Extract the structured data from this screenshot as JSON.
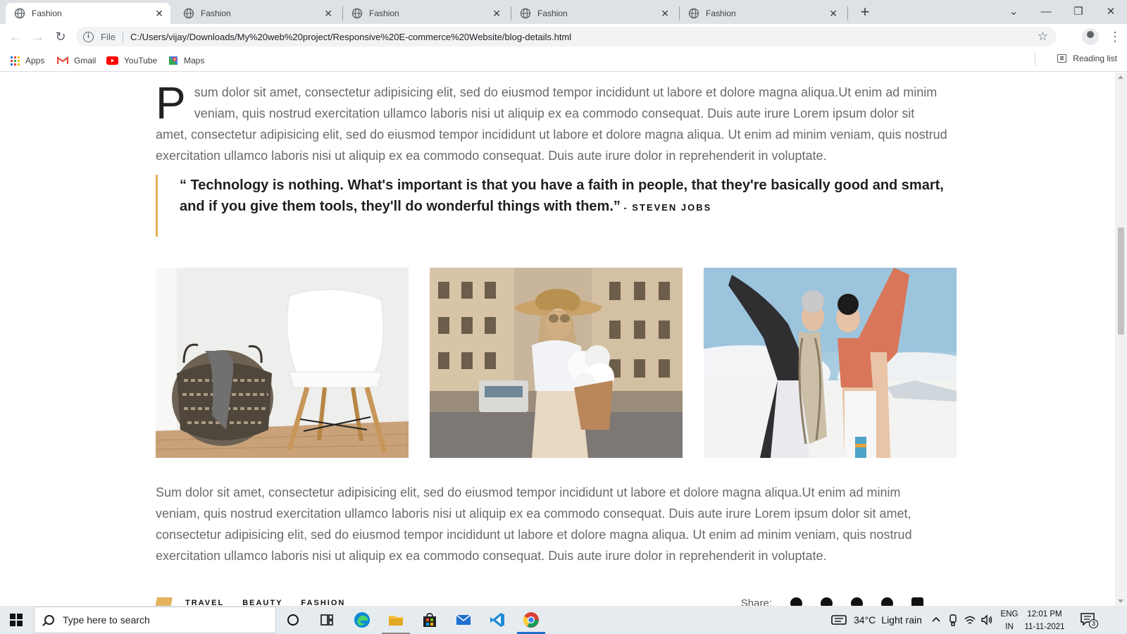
{
  "browser": {
    "tabs": [
      {
        "title": "Fashion",
        "active": true
      },
      {
        "title": "Fashion",
        "active": false
      },
      {
        "title": "Fashion",
        "active": false
      },
      {
        "title": "Fashion",
        "active": false
      },
      {
        "title": "Fashion",
        "active": false
      }
    ],
    "tab_close_glyph": "✕",
    "new_tab_glyph": "+",
    "window_controls": {
      "tab_search": "⌄",
      "minimize": "—",
      "restore": "❐",
      "close": "✕"
    },
    "nav": {
      "back": "←",
      "forward": "→",
      "reload": "↻"
    },
    "address": {
      "scheme_label": "File",
      "url": "C:/Users/vijay/Downloads/My%20web%20project/Responsive%20E-commerce%20Website/blog-details.html",
      "star_glyph": "☆"
    },
    "menu_glyph": "⋮",
    "bookmarks": [
      {
        "label": "Apps",
        "icon": "apps-grid-icon"
      },
      {
        "label": "Gmail",
        "icon": "gmail-icon"
      },
      {
        "label": "YouTube",
        "icon": "youtube-icon"
      },
      {
        "label": "Maps",
        "icon": "maps-icon"
      }
    ],
    "reading_list": "Reading list"
  },
  "article": {
    "dropcap": "P",
    "paragraph_1": "sum dolor sit amet, consectetur adipisicing elit, sed do eiusmod tempor incididunt ut labore et dolore magna aliqua.Ut enim ad minim veniam, quis nostrud exercitation ullamco laboris nisi ut aliquip ex ea commodo consequat. Duis aute irure Lorem ipsum dolor sit amet, consectetur adipisicing elit, sed do eiusmod tempor incididunt ut labore et dolore magna aliqua. Ut enim ad minim veniam, quis nostrud exercitation ullamco laboris nisi ut aliquip ex ea commodo consequat. Duis aute irure dolor in reprehenderit in voluptate.",
    "quote": "“ Technology is nothing. What's important is that you have a faith in people, that they're basically good and smart, and if you give them tools, they'll do wonderful things with them.”",
    "quote_author": "- STEVEN JOBS",
    "images": [
      {
        "subject": "basket-and-white-chair"
      },
      {
        "subject": "woman-in-hat-with-flowers"
      },
      {
        "subject": "two-friends-in-snow"
      }
    ],
    "paragraph_2": "Sum dolor sit amet, consectetur adipisicing elit, sed do eiusmod tempor incididunt ut labore et dolore magna aliqua.Ut enim ad minim veniam, quis nostrud exercitation ullamco laboris nisi ut aliquip ex ea commodo consequat. Duis aute irure Lorem ipsum dolor sit amet, consectetur adipisicing elit, sed do eiusmod tempor incididunt ut labore et dolore magna aliqua. Ut enim ad minim veniam, quis nostrud exercitation ullamco laboris nisi ut aliquip ex ea commodo consequat. Duis aute irure dolor in reprehenderit in voluptate.",
    "tags": [
      "TRAVEL",
      "BEAUTY",
      "FASHION"
    ],
    "share_label": "Share:",
    "share_icons": [
      "facebook-icon",
      "twitter-icon",
      "pinterest-icon",
      "instagram-icon",
      "youtube-icon"
    ],
    "accent_color": "#e4b15c"
  },
  "taskbar": {
    "search_placeholder": "Type here to search",
    "apps": [
      "cortana-icon",
      "task-view-icon",
      "edge-icon",
      "file-explorer-icon",
      "store-icon",
      "mail-icon",
      "vscode-icon",
      "chrome-icon"
    ],
    "weather": {
      "temp": "34°C",
      "condition": "Light rain"
    },
    "language": {
      "line1": "ENG",
      "line2": "IN"
    },
    "clock": {
      "time": "12:01 PM",
      "date": "11-11-2021"
    },
    "notifications_count": "3"
  }
}
